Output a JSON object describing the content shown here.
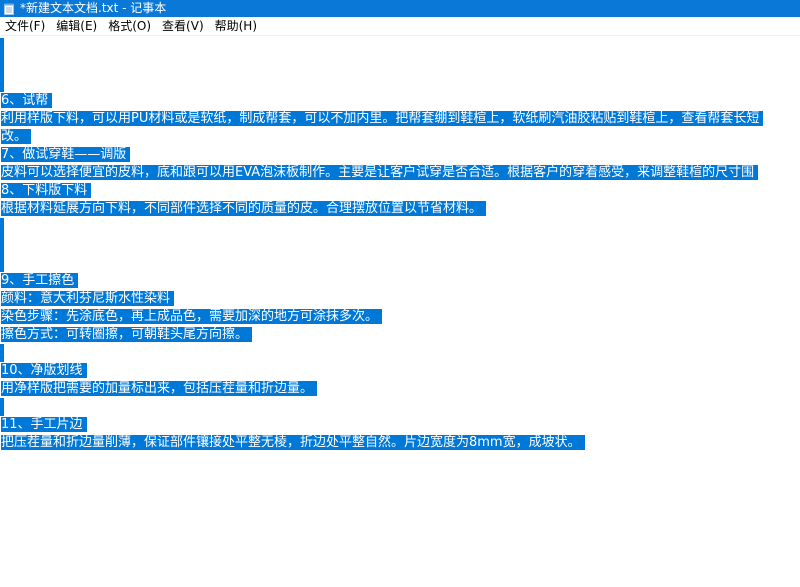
{
  "window": {
    "title": "*新建文本文档.txt - 记事本",
    "icon": "notepad-icon"
  },
  "menu": [
    "文件(F)",
    "编辑(E)",
    "格式(O)",
    "查看(V)",
    "帮助(H)"
  ],
  "editor": {
    "lines": [
      "6、试帮",
      "利用样版下料，可以用PU材料或是软纸，制成帮套，可以不加内里。把帮套绷到鞋楦上，软纸刷汽油胶粘贴到鞋楦上，查看帮套长短",
      "改。",
      "7、做试穿鞋——调版",
      "皮料可以选择便宜的皮料，底和跟可以用EVA泡沫板制作。主要是让客户试穿是否合适。根据客户的穿着感受，来调整鞋楦的尺寸围",
      "8、下料版下料",
      "根据材料延展方向下料，不同部件选择不同的质量的皮。合理摆放位置以节省材料。",
      "9、手工擦色",
      "颜料：意大利芬尼斯水性染料",
      "染色步骤：先涂底色，再上成品色，需要加深的地方可涂抹多次。",
      "擦色方式：可转圈擦，可朝鞋头尾方向擦。",
      "10、净版划线",
      "用净样版把需要的加量标出来，包括压茬量和折边量。",
      "11、手工片边",
      "把压茬量和折边量削薄，保证部件镶接处平整无棱，折边处平整自然。片边宽度为8mm宽，成坡状。"
    ]
  }
}
